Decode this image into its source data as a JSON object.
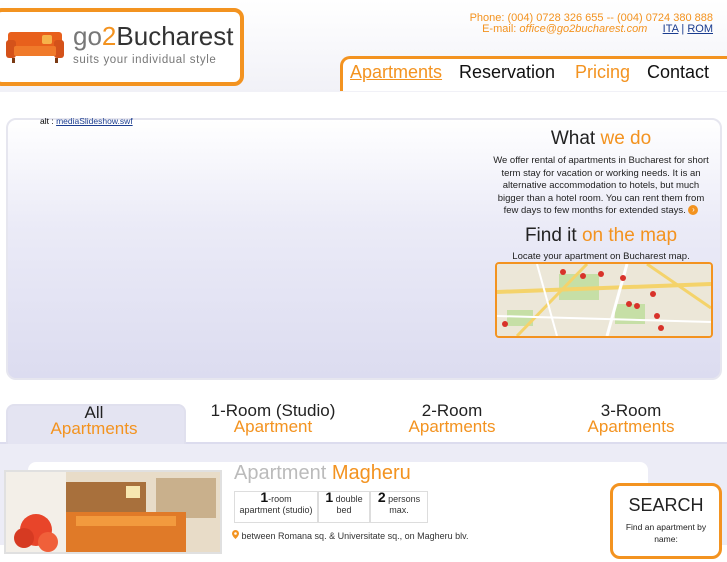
{
  "brand": {
    "go": "go",
    "two": "2",
    "city": "Bucharest",
    "tagline": "suits your individual style"
  },
  "contact": {
    "phone_label": "Phone:",
    "phone": "(004) 0728 326 655 -- (004) 0724 380 888",
    "email_label": "E-mail:",
    "email": "office@go2bucharest.com",
    "lang_ita": "ITA",
    "lang_sep": "|",
    "lang_rom": "ROM"
  },
  "nav": {
    "apartments": "Apartments",
    "reservation": "Reservation",
    "pricing": "Pricing",
    "contact": "Contact"
  },
  "slideshow": {
    "alt_label": "alt :",
    "alt_file": "mediaSlideshow.swf"
  },
  "what": {
    "h_dark": "What",
    "h_orange": "we do",
    "text": "We offer rental of apartments in Bucharest for short term stay for vacation or working needs. It is an alternative accommodation to hotels, but much bigger than a hotel room. You can rent them from few days to few months for extended stays."
  },
  "find": {
    "h_dark": "Find it",
    "h_orange": "on the map",
    "text": "Locate your apartment on Bucharest map."
  },
  "tabs": [
    {
      "top": "All",
      "bottom": "Apartments"
    },
    {
      "top": "1-Room (Studio)",
      "bottom": "Apartment"
    },
    {
      "top": "2-Room",
      "bottom": "Apartments"
    },
    {
      "top": "3-Room",
      "bottom": "Apartments"
    }
  ],
  "listing": {
    "title_light": "Apartment",
    "title_orange": "Magheru",
    "specs": [
      {
        "num": "1",
        "suffix": "-room",
        "sub": "apartment (studio)"
      },
      {
        "num": "1",
        "suffix": " double",
        "sub": "bed"
      },
      {
        "num": "2",
        "suffix": " persons",
        "sub": "max."
      }
    ],
    "address": "between Romana sq. & Universitate sq., on Magheru blv."
  },
  "search": {
    "title": "SEARCH",
    "sub": "Find an apartment by name:"
  },
  "colors": {
    "accent": "#f39320",
    "link": "#1a3c8f",
    "panel": "#dcdcf0"
  }
}
